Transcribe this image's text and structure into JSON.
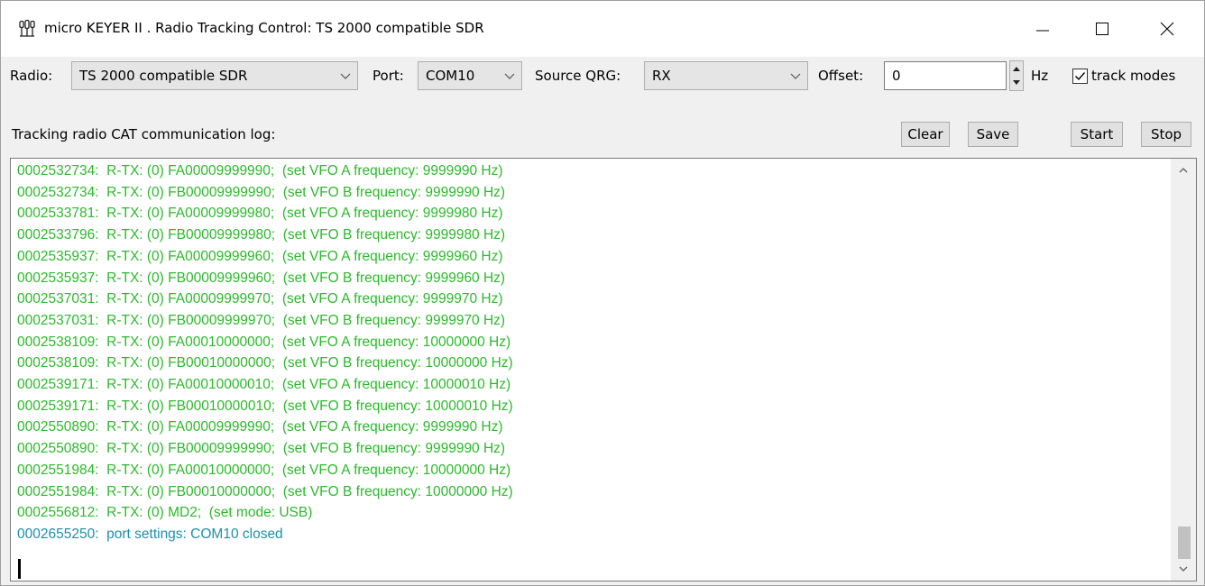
{
  "window": {
    "title": "micro KEYER II . Radio Tracking Control: TS 2000 compatible SDR"
  },
  "toolbar": {
    "radio_label": "Radio:",
    "radio_value": "TS 2000 compatible SDR",
    "port_label": "Port:",
    "port_value": "COM10",
    "source_label": "Source QRG:",
    "source_value": "RX",
    "offset_label": "Offset:",
    "offset_value": "0",
    "hz_label": "Hz",
    "track_modes_label": "track modes",
    "track_modes_checked": true
  },
  "log": {
    "header": "Tracking radio CAT communication log:",
    "clear_label": "Clear",
    "save_label": "Save",
    "start_label": "Start",
    "stop_label": "Stop",
    "colors": {
      "tx": "#2db82d",
      "info": "#1e8fa8"
    },
    "lines": [
      {
        "text": "0002532734:  R-TX: (0) FA00009999990;  (set VFO A frequency: 9999990 Hz)",
        "kind": "green"
      },
      {
        "text": "0002532734:  R-TX: (0) FB00009999990;  (set VFO B frequency: 9999990 Hz)",
        "kind": "green"
      },
      {
        "text": "0002533781:  R-TX: (0) FA00009999980;  (set VFO A frequency: 9999980 Hz)",
        "kind": "green"
      },
      {
        "text": "0002533796:  R-TX: (0) FB00009999980;  (set VFO B frequency: 9999980 Hz)",
        "kind": "green"
      },
      {
        "text": "0002535937:  R-TX: (0) FA00009999960;  (set VFO A frequency: 9999960 Hz)",
        "kind": "green"
      },
      {
        "text": "0002535937:  R-TX: (0) FB00009999960;  (set VFO B frequency: 9999960 Hz)",
        "kind": "green"
      },
      {
        "text": "0002537031:  R-TX: (0) FA00009999970;  (set VFO A frequency: 9999970 Hz)",
        "kind": "green"
      },
      {
        "text": "0002537031:  R-TX: (0) FB00009999970;  (set VFO B frequency: 9999970 Hz)",
        "kind": "green"
      },
      {
        "text": "0002538109:  R-TX: (0) FA00010000000;  (set VFO A frequency: 10000000 Hz)",
        "kind": "green"
      },
      {
        "text": "0002538109:  R-TX: (0) FB00010000000;  (set VFO B frequency: 10000000 Hz)",
        "kind": "green"
      },
      {
        "text": "0002539171:  R-TX: (0) FA00010000010;  (set VFO A frequency: 10000010 Hz)",
        "kind": "green"
      },
      {
        "text": "0002539171:  R-TX: (0) FB00010000010;  (set VFO B frequency: 10000010 Hz)",
        "kind": "green"
      },
      {
        "text": "0002550890:  R-TX: (0) FA00009999990;  (set VFO A frequency: 9999990 Hz)",
        "kind": "green"
      },
      {
        "text": "0002550890:  R-TX: (0) FB00009999990;  (set VFO B frequency: 9999990 Hz)",
        "kind": "green"
      },
      {
        "text": "0002551984:  R-TX: (0) FA00010000000;  (set VFO A frequency: 10000000 Hz)",
        "kind": "green"
      },
      {
        "text": "0002551984:  R-TX: (0) FB00010000000;  (set VFO B frequency: 10000000 Hz)",
        "kind": "green"
      },
      {
        "text": "0002556812:  R-TX: (0) MD2;  (set mode: USB)",
        "kind": "green"
      },
      {
        "text": "0002655250:  port settings: COM10 closed",
        "kind": "teal"
      }
    ]
  }
}
